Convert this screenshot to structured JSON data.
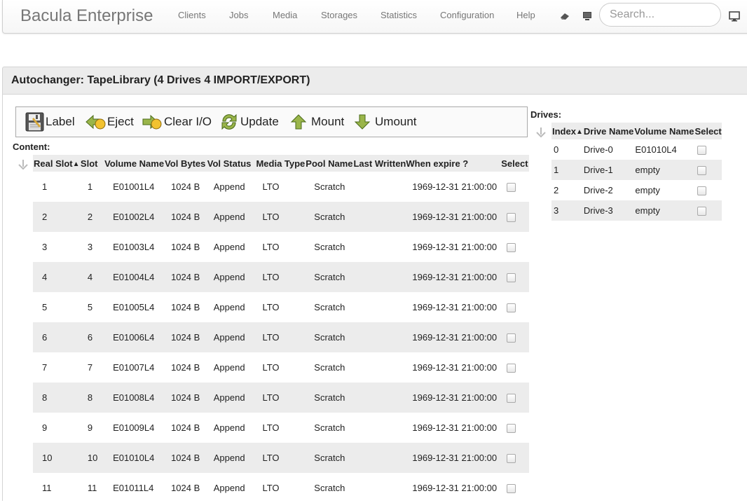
{
  "nav": {
    "brand": "Bacula Enterprise",
    "links": [
      "Clients",
      "Jobs",
      "Media",
      "Storages",
      "Statistics",
      "Configuration",
      "Help"
    ],
    "search_placeholder": "Search..."
  },
  "panel": {
    "title": "Autochanger: TapeLibrary (4 Drives 4 IMPORT/EXPORT)"
  },
  "actions": {
    "label": "Label",
    "eject": "Eject",
    "clear_io": "Clear I/O",
    "update": "Update",
    "mount": "Mount",
    "umount": "Umount"
  },
  "content": {
    "label": "Content:",
    "columns": [
      "Real Slot",
      "Slot",
      "Volume Name",
      "Vol Bytes",
      "Vol Status",
      "Media Type",
      "Pool Name",
      "Last Written",
      "When expire ?",
      "Select"
    ],
    "sort_indicator": "▲",
    "rows": [
      {
        "real_slot": "1",
        "slot": "1",
        "volume": "E01001L4",
        "bytes": "1024 B",
        "status": "Append",
        "media": "LTO",
        "pool": "Scratch",
        "last_written": "",
        "expire": "1969-12-31 21:00:00"
      },
      {
        "real_slot": "2",
        "slot": "2",
        "volume": "E01002L4",
        "bytes": "1024 B",
        "status": "Append",
        "media": "LTO",
        "pool": "Scratch",
        "last_written": "",
        "expire": "1969-12-31 21:00:00"
      },
      {
        "real_slot": "3",
        "slot": "3",
        "volume": "E01003L4",
        "bytes": "1024 B",
        "status": "Append",
        "media": "LTO",
        "pool": "Scratch",
        "last_written": "",
        "expire": "1969-12-31 21:00:00"
      },
      {
        "real_slot": "4",
        "slot": "4",
        "volume": "E01004L4",
        "bytes": "1024 B",
        "status": "Append",
        "media": "LTO",
        "pool": "Scratch",
        "last_written": "",
        "expire": "1969-12-31 21:00:00"
      },
      {
        "real_slot": "5",
        "slot": "5",
        "volume": "E01005L4",
        "bytes": "1024 B",
        "status": "Append",
        "media": "LTO",
        "pool": "Scratch",
        "last_written": "",
        "expire": "1969-12-31 21:00:00"
      },
      {
        "real_slot": "6",
        "slot": "6",
        "volume": "E01006L4",
        "bytes": "1024 B",
        "status": "Append",
        "media": "LTO",
        "pool": "Scratch",
        "last_written": "",
        "expire": "1969-12-31 21:00:00"
      },
      {
        "real_slot": "7",
        "slot": "7",
        "volume": "E01007L4",
        "bytes": "1024 B",
        "status": "Append",
        "media": "LTO",
        "pool": "Scratch",
        "last_written": "",
        "expire": "1969-12-31 21:00:00"
      },
      {
        "real_slot": "8",
        "slot": "8",
        "volume": "E01008L4",
        "bytes": "1024 B",
        "status": "Append",
        "media": "LTO",
        "pool": "Scratch",
        "last_written": "",
        "expire": "1969-12-31 21:00:00"
      },
      {
        "real_slot": "9",
        "slot": "9",
        "volume": "E01009L4",
        "bytes": "1024 B",
        "status": "Append",
        "media": "LTO",
        "pool": "Scratch",
        "last_written": "",
        "expire": "1969-12-31 21:00:00"
      },
      {
        "real_slot": "10",
        "slot": "10",
        "volume": "E01010L4",
        "bytes": "1024 B",
        "status": "Append",
        "media": "LTO",
        "pool": "Scratch",
        "last_written": "",
        "expire": "1969-12-31 21:00:00"
      },
      {
        "real_slot": "11",
        "slot": "11",
        "volume": "E01011L4",
        "bytes": "1024 B",
        "status": "Append",
        "media": "LTO",
        "pool": "Scratch",
        "last_written": "",
        "expire": "1969-12-31 21:00:00"
      }
    ]
  },
  "drives": {
    "label": "Drives:",
    "columns": [
      "Index",
      "Drive Name",
      "Volume Name",
      "Select"
    ],
    "sort_indicator": "▲",
    "rows": [
      {
        "index": "0",
        "name": "Drive-0",
        "volume": "E01010L4"
      },
      {
        "index": "1",
        "name": "Drive-1",
        "volume": "empty"
      },
      {
        "index": "2",
        "name": "Drive-2",
        "volume": "empty"
      },
      {
        "index": "3",
        "name": "Drive-3",
        "volume": "empty"
      }
    ]
  }
}
